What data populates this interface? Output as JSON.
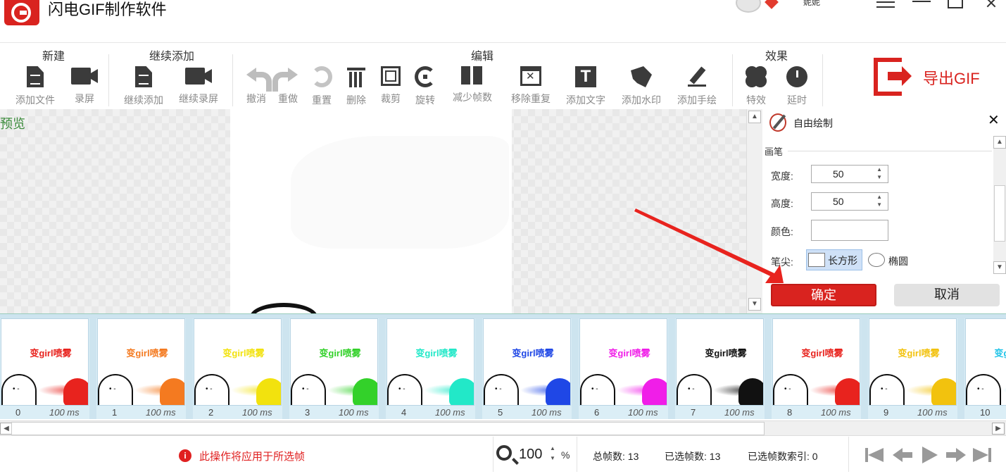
{
  "app": {
    "title": "闪电GIF制作软件",
    "username": "妮妮"
  },
  "toolbar": {
    "groups": {
      "new": "新建",
      "append": "继续添加",
      "edit": "编辑",
      "effects": "效果"
    },
    "tools": {
      "add_file": "添加文件",
      "record": "录屏",
      "append_add": "继续添加",
      "append_record": "继续录屏",
      "undo": "撤消",
      "redo": "重做",
      "reset": "重置",
      "delete": "删除",
      "crop": "裁剪",
      "rotate": "旋转",
      "reduce_frames": "减少帧数",
      "remove_duplicates": "移除重复",
      "add_text": "添加文字",
      "add_watermark": "添加水印",
      "add_drawing": "添加手绘",
      "effects": "特效",
      "delay": "延时"
    },
    "export_label": "导出GIF"
  },
  "preview": {
    "label": "预览"
  },
  "panel": {
    "title": "自由绘制",
    "section": "画笔",
    "width_label": "宽度:",
    "width_value": "50",
    "height_label": "高度:",
    "height_value": "50",
    "color_label": "颜色:",
    "tip_label": "笔尖:",
    "tip_rect": "长方形",
    "tip_ellipse": "椭圆",
    "ok": "确定",
    "cancel": "取消"
  },
  "frames": [
    {
      "index": "0",
      "ms": "100 ms",
      "caption": "变girl喷雾",
      "color": "#e8231e"
    },
    {
      "index": "1",
      "ms": "100 ms",
      "caption": "变girl喷雾",
      "color": "#f47a20"
    },
    {
      "index": "2",
      "ms": "100 ms",
      "caption": "变girl喷雾",
      "color": "#f2e20e"
    },
    {
      "index": "3",
      "ms": "100 ms",
      "caption": "变girl喷雾",
      "color": "#33d12a"
    },
    {
      "index": "4",
      "ms": "100 ms",
      "caption": "变girl喷雾",
      "color": "#22e8c8"
    },
    {
      "index": "5",
      "ms": "100 ms",
      "caption": "变girl喷雾",
      "color": "#1f47e6"
    },
    {
      "index": "6",
      "ms": "100 ms",
      "caption": "变girl喷雾",
      "color": "#f01ee8"
    },
    {
      "index": "7",
      "ms": "100 ms",
      "caption": "变girl喷雾",
      "color": "#111111"
    },
    {
      "index": "8",
      "ms": "100 ms",
      "caption": "变girl喷雾",
      "color": "#e8231e"
    },
    {
      "index": "9",
      "ms": "100 ms",
      "caption": "变girl喷雾",
      "color": "#f2c20e"
    },
    {
      "index": "10",
      "ms": "",
      "caption": "变girl喷雾",
      "color": "#22c4e8"
    }
  ],
  "status": {
    "warning": "此操作将应用于所选帧",
    "zoom": "100",
    "zoom_unit": "%",
    "total_frames": "总帧数: 13",
    "selected_frames": "已选帧数: 13",
    "selected_index": "已选帧数索引: 0"
  },
  "colors": {
    "accent": "#d9231f",
    "warning": "#e02020",
    "strip_bg": "#cde4ef"
  }
}
